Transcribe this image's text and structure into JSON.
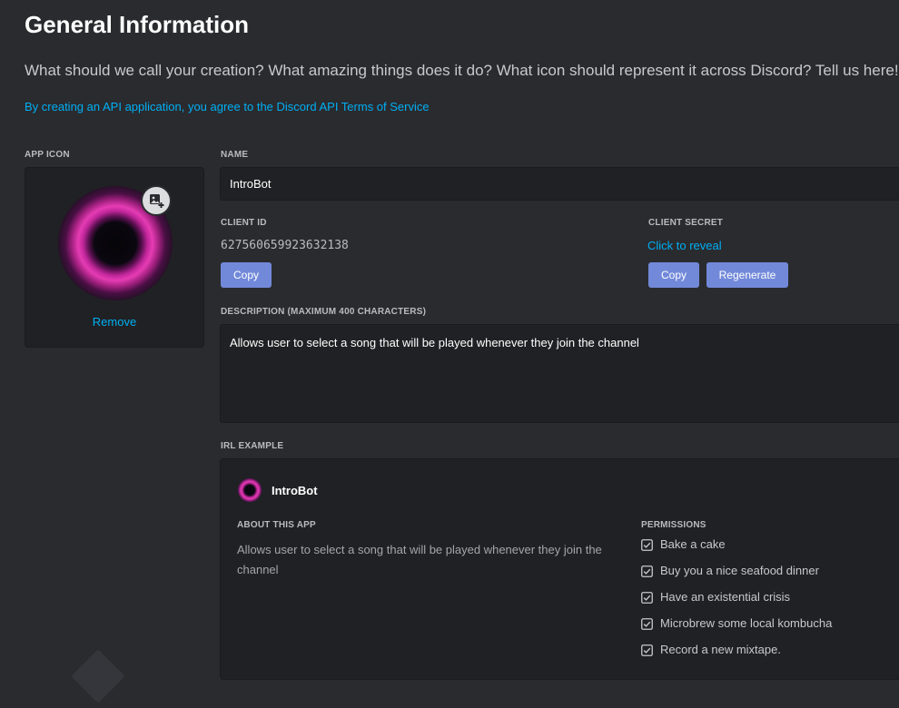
{
  "header": {
    "title": "General Information",
    "subtitle": "What should we call your creation? What amazing things does it do? What icon should represent it across Discord? Tell us here!",
    "tos_link": "By creating an API application, you agree to the Discord API Terms of Service"
  },
  "app_icon": {
    "label": "APP ICON",
    "remove_label": "Remove",
    "upload_icon": "image-upload-icon"
  },
  "name": {
    "label": "NAME",
    "value": "IntroBot"
  },
  "client_id": {
    "label": "CLIENT ID",
    "value": "627560659923632138",
    "copy_label": "Copy"
  },
  "client_secret": {
    "label": "CLIENT SECRET",
    "reveal_label": "Click to reveal",
    "copy_label": "Copy",
    "regenerate_label": "Regenerate"
  },
  "description": {
    "label": "DESCRIPTION (MAXIMUM 400 CHARACTERS)",
    "value": "Allows user to select a song that will be played whenever they join the channel"
  },
  "irl_example": {
    "label": "IRL EXAMPLE",
    "bot_name": "IntroBot",
    "about_label": "ABOUT THIS APP",
    "about_text": "Allows user to select a song that will be played whenever they join the channel",
    "permissions_label": "PERMISSIONS",
    "permissions": [
      "Bake a cake",
      "Buy you a nice seafood dinner",
      "Have an existential crisis",
      "Microbrew some local kombucha",
      "Record a new mixtape."
    ]
  },
  "colors": {
    "background": "#2a2b2f",
    "panel": "#202124",
    "accent": "#7289da",
    "link": "#00aff4"
  }
}
